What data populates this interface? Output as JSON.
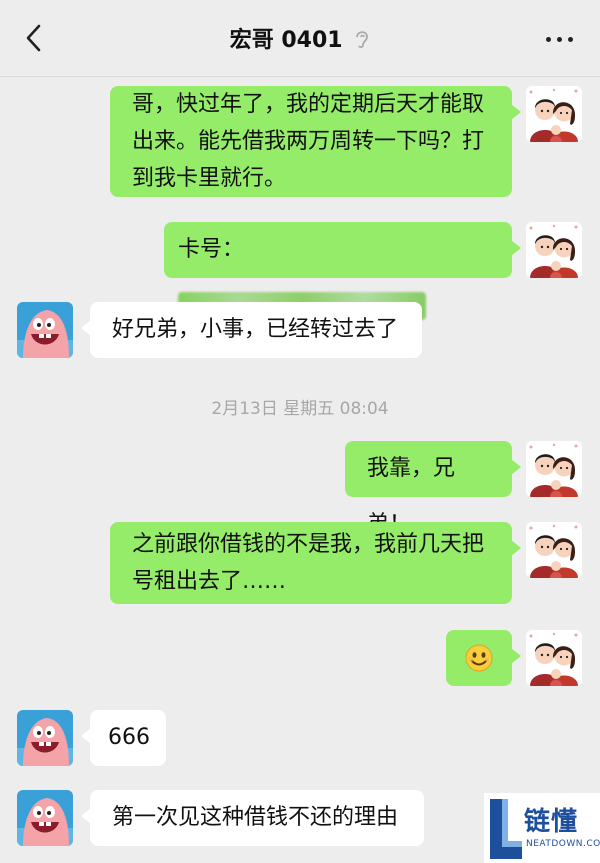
{
  "header": {
    "title": "宏哥 0401"
  },
  "messages": {
    "m1": {
      "line1": "哥，快过年了，我的定期后天才能取",
      "line2": "出来。能先借我两万周转一下吗？打",
      "line3": "到我卡里就行。"
    },
    "m2": {
      "label": "卡号："
    },
    "m3": {
      "text": "好兄弟，小事，已经转过去了"
    },
    "timestamp": "2月13日 星期五 08:04",
    "m4": {
      "text": "我靠，兄弟！"
    },
    "m5": {
      "line1": "之前跟你借钱的不是我，我前几天把",
      "line2": "号租出去了……"
    },
    "m6": {
      "emoji": "😊"
    },
    "m7": {
      "text": "666"
    },
    "m8": {
      "text": "第一次见这种借钱不还的理由"
    }
  },
  "watermark": {
    "brand": "链懂",
    "sub": "NEATDOWN.COM",
    "logo_letter": "L"
  },
  "colors": {
    "bubble_green": "#95ec69",
    "bubble_white": "#ffffff",
    "background": "#ededed"
  }
}
